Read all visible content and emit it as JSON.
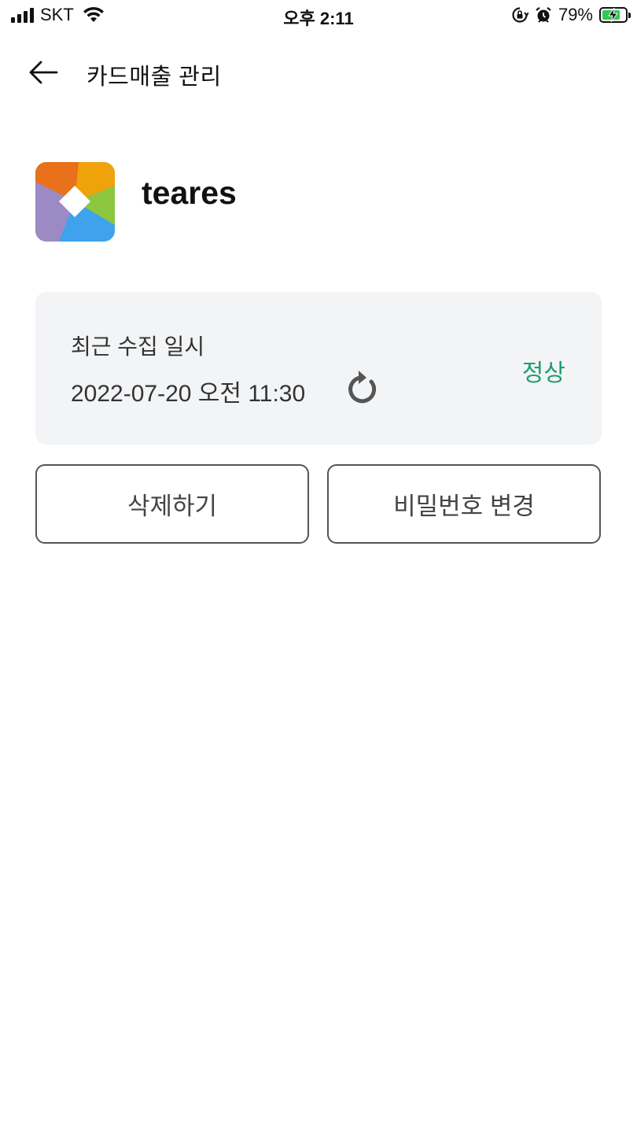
{
  "status_bar": {
    "carrier": "SKT",
    "time": "오후 2:11",
    "battery_percent": "79%",
    "battery_level": 0.79,
    "icons": [
      "signal-icon",
      "wifi-icon",
      "orientation-lock-icon",
      "alarm-icon",
      "battery-charging-icon"
    ]
  },
  "header": {
    "title": "카드매출 관리",
    "back_icon": "arrow-left-icon"
  },
  "app": {
    "name": "teares",
    "logo_icon": "teares-logo-icon"
  },
  "collection": {
    "label": "최근 수집 일시",
    "datetime": "2022-07-20 오전 11:30",
    "refresh_icon": "refresh-icon",
    "status": "정상",
    "status_color": "#1f9d70"
  },
  "actions": {
    "delete_label": "삭제하기",
    "change_password_label": "비밀번호 변경"
  }
}
